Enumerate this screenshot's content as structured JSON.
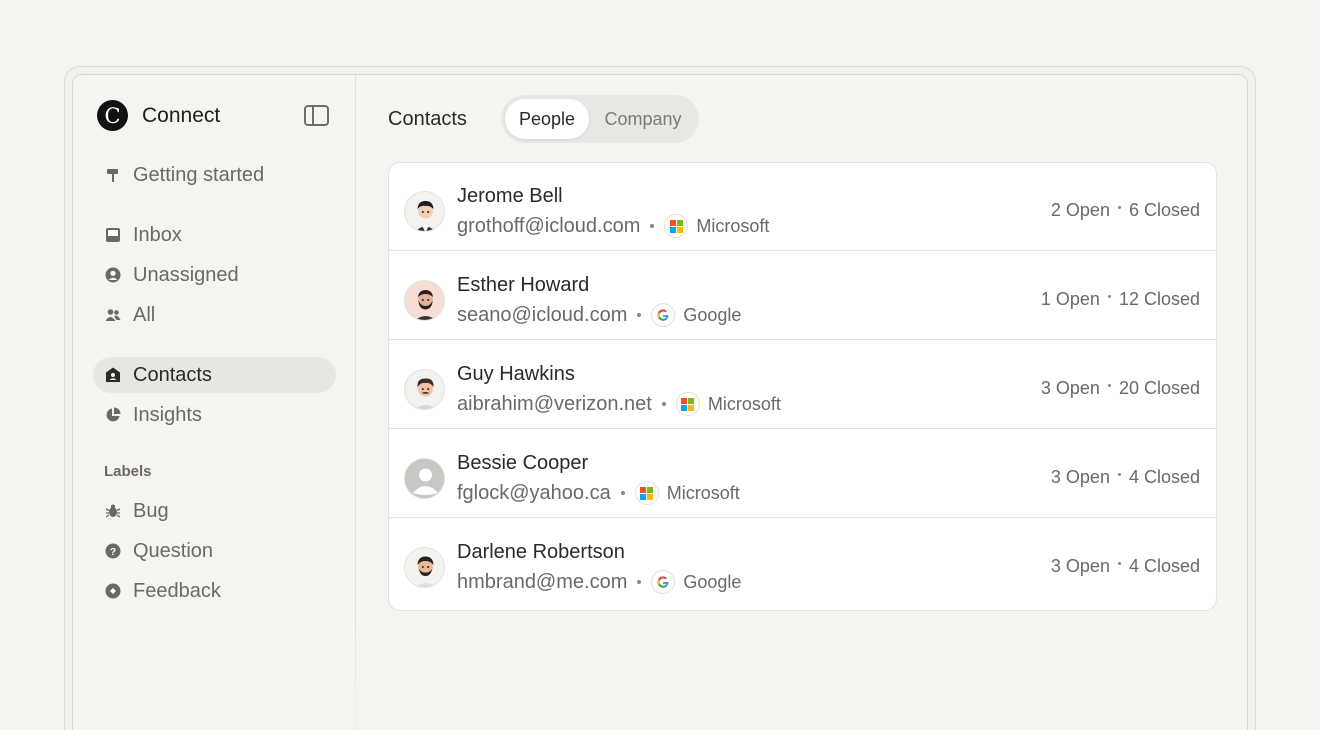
{
  "app": {
    "name": "Connect",
    "logo_letter": "C"
  },
  "sidebar": {
    "items": [
      {
        "label": "Getting started",
        "icon": "signpost-icon"
      },
      {
        "label": "Inbox",
        "icon": "inbox-icon"
      },
      {
        "label": "Unassigned",
        "icon": "user-circle-icon"
      },
      {
        "label": "All",
        "icon": "users-icon"
      },
      {
        "label": "Contacts",
        "icon": "contact-book-icon",
        "active": true
      },
      {
        "label": "Insights",
        "icon": "pie-chart-icon"
      }
    ],
    "labels_heading": "Labels",
    "labels": [
      {
        "label": "Bug",
        "icon": "bug-icon"
      },
      {
        "label": "Question",
        "icon": "question-icon"
      },
      {
        "label": "Feedback",
        "icon": "feedback-icon"
      }
    ]
  },
  "main": {
    "title": "Contacts",
    "tabs": [
      {
        "label": "People",
        "selected": true
      },
      {
        "label": "Company",
        "selected": false
      }
    ],
    "contacts": [
      {
        "name": "Jerome Bell",
        "email": "grothoff@icloud.com",
        "company": "Microsoft",
        "open": "2 Open",
        "closed": "6 Closed",
        "avatar": "avatar-suit-man"
      },
      {
        "name": "Esther Howard",
        "email": "seano@icloud.com",
        "company": "Google",
        "open": "1 Open",
        "closed": "12 Closed",
        "avatar": "avatar-bearded-man"
      },
      {
        "name": "Guy Hawkins",
        "email": "aibrahim@verizon.net",
        "company": "Microsoft",
        "open": "3 Open",
        "closed": "20 Closed",
        "avatar": "avatar-mustache-man"
      },
      {
        "name": "Bessie Cooper",
        "email": "fglock@yahoo.ca",
        "company": "Microsoft",
        "open": "3 Open",
        "closed": "4 Closed",
        "avatar": "avatar-placeholder"
      },
      {
        "name": "Darlene Robertson",
        "email": "hmbrand@me.com",
        "company": "Google",
        "open": "3 Open",
        "closed": "4 Closed",
        "avatar": "avatar-bearded-man-2"
      }
    ]
  },
  "colors": {
    "background": "#f4f3f0",
    "active_nav": "#e8e6e2",
    "text_primary": "#2b2a27",
    "text_secondary": "#6b6964",
    "microsoft": [
      "#f25022",
      "#7fba00",
      "#00a4ef",
      "#ffb900"
    ],
    "google": [
      "#4285f4",
      "#ea4335",
      "#fbbc05",
      "#34a853"
    ]
  }
}
